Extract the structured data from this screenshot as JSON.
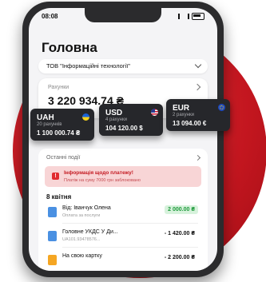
{
  "status": {
    "time": "08:08"
  },
  "page": {
    "title": "Головна"
  },
  "company": {
    "name": "ТОВ \"Інформаційні технології\""
  },
  "accounts": {
    "label": "Рахунки",
    "total": "3 220 934.74 ₴"
  },
  "currency_cards": [
    {
      "code": "UAH",
      "sub": "20 рахунків",
      "balance": "1 100 000.74 ₴",
      "flag": "ua-flag-icon"
    },
    {
      "code": "USD",
      "sub": "4 рахунки",
      "balance": "104 120.00 $",
      "flag": "us-flag-icon"
    },
    {
      "code": "EUR",
      "sub": "2 рахунки",
      "balance": "13 094.00 €",
      "flag": "eu-flag-icon"
    }
  ],
  "events": {
    "header": "Останні події",
    "alert": {
      "title": "Інформація щодо платежу!",
      "text": "Платіж на суму 7000 грн заблоковано"
    },
    "date": "8 квітня",
    "transactions": [
      {
        "name": "Від: Іванчук Олена",
        "sub": "Оплата за послуги",
        "amount": "2 000.00 ₴",
        "type": "pos",
        "icon_color": "#4a90e2"
      },
      {
        "name": "Головне УКДС У Ди...",
        "sub": "UA101.93478576...",
        "amount": "- 1 420.00 ₴",
        "type": "neg",
        "icon_color": "#4a90e2"
      },
      {
        "name": "На свою картку",
        "sub": "",
        "amount": "- 2 200.00 ₴",
        "type": "neg",
        "icon_color": "#f5a623"
      }
    ]
  }
}
